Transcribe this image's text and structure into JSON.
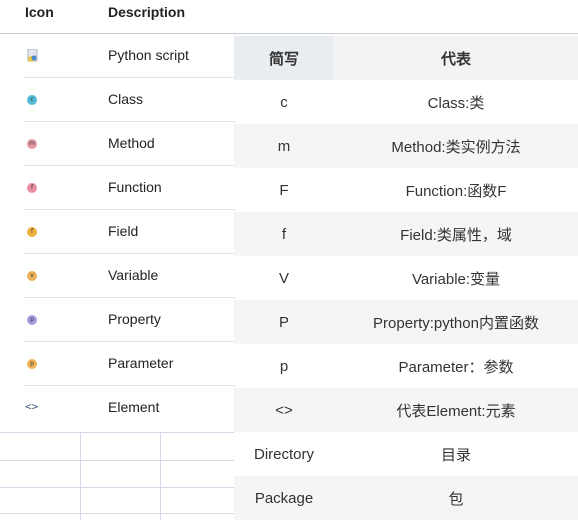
{
  "left_table": {
    "header": {
      "icon": "Icon",
      "description": "Description"
    },
    "rows": [
      {
        "icon": "python-script-icon",
        "letter": "",
        "color": "#f0c94a",
        "label": "Python script"
      },
      {
        "icon": "class-icon",
        "letter": "c",
        "color": "#57b9d8",
        "label": "Class"
      },
      {
        "icon": "method-icon",
        "letter": "m",
        "color": "#e59aa8",
        "label": "Method"
      },
      {
        "icon": "function-icon",
        "letter": "f",
        "color": "#e88ea0",
        "label": "Function"
      },
      {
        "icon": "field-icon",
        "letter": "f",
        "color": "#f0b040",
        "label": "Field"
      },
      {
        "icon": "variable-icon",
        "letter": "v",
        "color": "#e8b25a",
        "label": "Variable"
      },
      {
        "icon": "property-icon",
        "letter": "p",
        "color": "#a99be0",
        "label": "Property"
      },
      {
        "icon": "parameter-icon",
        "letter": "p",
        "color": "#f0b35a",
        "label": "Parameter"
      },
      {
        "icon": "element-icon",
        "letter": "<>",
        "color": "#4c5a88",
        "label": "Element"
      }
    ]
  },
  "right_table": {
    "header": {
      "abbr": "简写",
      "meaning": "代表"
    },
    "rows": [
      {
        "abbr": "c",
        "meaning": "Class:类"
      },
      {
        "abbr": "m",
        "meaning": "Method:类实例方法"
      },
      {
        "abbr": "F",
        "meaning": "Function:函数F"
      },
      {
        "abbr": "f",
        "meaning": "Field:类属性，域"
      },
      {
        "abbr": "V",
        "meaning": "Variable:变量"
      },
      {
        "abbr": "P",
        "meaning": "Property:python内置函数"
      },
      {
        "abbr": "p",
        "meaning": "Parameter：参数"
      },
      {
        "abbr": "<>",
        "meaning": "代表Element:元素"
      },
      {
        "abbr": "Directory",
        "meaning": "目录"
      },
      {
        "abbr": "Package",
        "meaning": "包"
      }
    ]
  }
}
